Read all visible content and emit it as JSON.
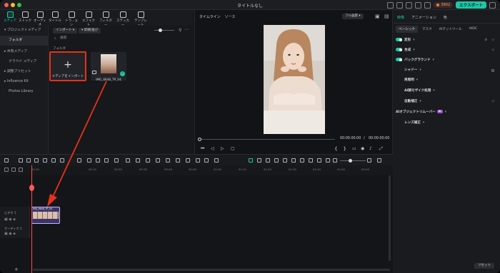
{
  "window": {
    "title": "タイトルなし",
    "points": "3602",
    "export_label": "エクスポート"
  },
  "toolbar": {
    "items": [
      {
        "label": "メディア"
      },
      {
        "label": "ストック"
      },
      {
        "label": "オーディオ"
      },
      {
        "label": "タイトル"
      },
      {
        "label": "トラ...ョン"
      },
      {
        "label": "エフェクト"
      },
      {
        "label": "フィルター"
      },
      {
        "label": "ステッカー"
      },
      {
        "label": "テンプレート"
      }
    ]
  },
  "sidebar": {
    "items": [
      {
        "label": "▾ プロジェクトメディア"
      },
      {
        "label": "フォルダ"
      },
      {
        "label": "▸ 共有メディア"
      },
      {
        "label": "クラウド メディア"
      },
      {
        "label": "▸ 調整プリセット"
      },
      {
        "label": "▸ Influence Kit"
      },
      {
        "label": "Photos Library"
      }
    ]
  },
  "media": {
    "import_dropdown": "インポート ▾",
    "sort_dropdown": "▾ 昇順/並び",
    "search_placeholder": "検索",
    "folder_label": "フォルダ",
    "import_tile_label": "メディアをインポート",
    "clip_name": "IMG_6648_TP_V4"
  },
  "player": {
    "tabs": [
      "タイムライン",
      "ソース"
    ],
    "quality": "フル画質 ▾",
    "current_time": "00:00:00:00",
    "separator": "/",
    "total_time": "00:00:00:00"
  },
  "properties": {
    "tabs": [
      "映像",
      "アニメーション",
      "色"
    ],
    "subtabs": [
      "ベーシック",
      "マスク",
      "AIマットツール",
      "AIDC"
    ],
    "rows": [
      {
        "label": "変形",
        "toggle": true
      },
      {
        "label": "合成",
        "toggle": true
      },
      {
        "label": "バックグラウンド",
        "toggle": true
      },
      {
        "label": "シャドー",
        "toggle": false
      },
      {
        "label": "再照明",
        "toggle": false
      },
      {
        "label": "AI顔モザイク処理",
        "toggle": false
      },
      {
        "label": "自動補正",
        "toggle": false
      },
      {
        "label": "AIオブジェクトリムーバー",
        "toggle": false,
        "badge": "AI"
      },
      {
        "label": "レンズ補正",
        "toggle": false
      }
    ],
    "reset_label": "リセット"
  },
  "timeline": {
    "ruler": [
      "00:00",
      "00:10",
      "00:20",
      "00:30",
      "00:40",
      "00:50",
      "01:00",
      "01:10",
      "01:20",
      "01:30",
      "01:40",
      "01:50",
      "02:00",
      "02:10",
      "02:20"
    ],
    "video_track_label": "ビデオ 1",
    "audio_track_label": "オーディオ 1",
    "clip_label": "IMG_6648_TP_V4"
  },
  "colors": {
    "accent": "#1ec8a5",
    "annotation": "#e8311b",
    "export": "#1ec8a5"
  },
  "icons": [
    "close-icon",
    "minimize-icon",
    "maximize-icon",
    "plus-icon",
    "search-icon",
    "play-icon",
    "stop-icon",
    "scissors-icon",
    "undo-icon",
    "redo-icon"
  ]
}
